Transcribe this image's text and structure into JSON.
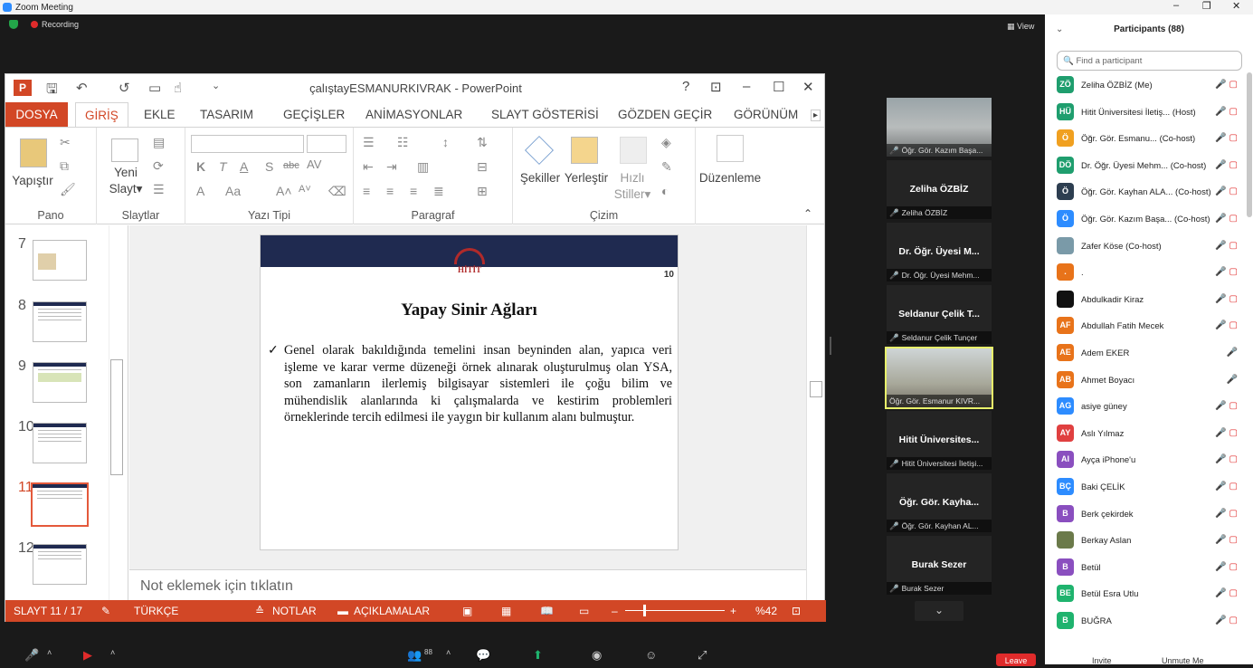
{
  "window": {
    "title": "Zoom Meeting"
  },
  "meeting": {
    "recording_label": "Recording",
    "view_label": "View"
  },
  "ppt": {
    "title": "çalıştayESMANURKIVRAK - PowerPoint",
    "tabs": [
      "DOSYA",
      "GİRİŞ",
      "EKLE",
      "TASARIM",
      "GEÇİŞLER",
      "ANİMASYONLAR",
      "SLAYT GÖSTERİSİ",
      "GÖZDEN GEÇİR",
      "GÖRÜNÜM"
    ],
    "ribbon": {
      "yapistir": "Yapıştır",
      "pano": "Pano",
      "yeni": "Yeni",
      "slayt": "Slayt",
      "slaytlar": "Slaytlar",
      "yazitipi": "Yazı Tipi",
      "paragraf": "Paragraf",
      "sekiller": "Şekiller",
      "yerlestir": "Yerleştir",
      "hizli": "Hızlı",
      "stiller": "Stiller",
      "cizim": "Çizim",
      "duzenleme": "Düzenleme",
      "k": "K",
      "t": "T",
      "a": "A",
      "s": "S",
      "abc": "abc",
      "av": "AV",
      "aa": "Aa"
    },
    "thumbnails": [
      "7",
      "8",
      "9",
      "10",
      "11",
      "12"
    ],
    "slide": {
      "number": "10",
      "logo": "HİTİT",
      "title": "Yapay Sinir Ağları",
      "body": "Genel olarak bakıldığında temelini insan beyninden alan, yapıca veri işleme ve karar verme düzeneği örnek alınarak oluşturulmuş olan YSA, son zamanların ilerlemiş bilgisayar sistemleri ile çoğu bilim ve mühendislik alanlarında ki çalışmalarda ve kestirim problemleri örneklerinde tercih edilmesi ile yaygın bir kullanım alanı bulmuştur."
    },
    "notes_placeholder": "Not eklemek için tıklatın",
    "status": {
      "slide": "SLAYT 11 / 17",
      "lang": "TÜRKÇE",
      "notes": "NOTLAR",
      "comments": "AÇIKLAMALAR",
      "zoom": "%42"
    }
  },
  "video_tiles": [
    {
      "name": "",
      "label": "Öğr. Gör. Kazım Başa..."
    },
    {
      "name": "Zeliha ÖZBİZ",
      "label": "Zeliha ÖZBİZ"
    },
    {
      "name": "Dr. Öğr. Üyesi M...",
      "label": "Dr. Öğr. Üyesi Mehm..."
    },
    {
      "name": "Seldanur Çelik T...",
      "label": "Seldanur Çelik Tunçer"
    },
    {
      "name": "",
      "label": "Öğr. Gör. Esmanur KIVR..."
    },
    {
      "name": "Hitit Üniversites...",
      "label": "Hitit Üniversitesi İletişi..."
    },
    {
      "name": "Öğr. Gör. Kayha...",
      "label": "Öğr. Gör. Kayhan AL..."
    },
    {
      "name": "Burak Sezer",
      "label": "Burak Sezer"
    }
  ],
  "participants": {
    "title": "Participants (88)",
    "search_placeholder": "Find a participant",
    "list": [
      {
        "initials": "ZÖ",
        "name": "Zeliha ÖZBİZ (Me)",
        "color": "#1f9e6e"
      },
      {
        "initials": "HÜ",
        "name": "Hitit Üniversitesi İletiş... (Host)",
        "color": "#1f9e6e"
      },
      {
        "initials": "Ö",
        "name": "Öğr. Gör. Esmanu... (Co-host)",
        "color": "#f0a020"
      },
      {
        "initials": "DÖ",
        "name": "Dr. Öğr. Üyesi Mehm... (Co-host)",
        "color": "#1f9e6e"
      },
      {
        "initials": "Ö",
        "name": "Öğr. Gör. Kayhan ALA... (Co-host)",
        "color": "#2d3e50"
      },
      {
        "initials": "Ö",
        "name": "Öğr. Gör. Kazım Başa... (Co-host)",
        "color": "#2d8cff"
      },
      {
        "initials": "",
        "name": "Zafer Köse (Co-host)",
        "color": "#7a9aa8"
      },
      {
        "initials": ".",
        "name": ".",
        "color": "#e8731a"
      },
      {
        "initials": "",
        "name": "Abdulkadir Kiraz",
        "color": "#111111"
      },
      {
        "initials": "AF",
        "name": "Abdullah Fatih Mecek",
        "color": "#e8731a"
      },
      {
        "initials": "AE",
        "name": "Adem EKER",
        "color": "#e8731a"
      },
      {
        "initials": "AB",
        "name": "Ahmet Boyacı",
        "color": "#e8731a"
      },
      {
        "initials": "AG",
        "name": "asiye güney",
        "color": "#2d8cff"
      },
      {
        "initials": "AY",
        "name": "Aslı Yılmaz",
        "color": "#e04040"
      },
      {
        "initials": "AI",
        "name": "Ayça iPhone'u",
        "color": "#8a4fbf"
      },
      {
        "initials": "BÇ",
        "name": "Baki ÇELİK",
        "color": "#2d8cff"
      },
      {
        "initials": "B",
        "name": "Berk çekirdek",
        "color": "#8a4fbf"
      },
      {
        "initials": "",
        "name": "Berkay Aslan",
        "color": "#6b7a4a"
      },
      {
        "initials": "B",
        "name": "Betül",
        "color": "#8a4fbf"
      },
      {
        "initials": "BE",
        "name": "Betül Esra Utlu",
        "color": "#1fb36e"
      },
      {
        "initials": "B",
        "name": "BUĞRA",
        "color": "#1fb36e"
      }
    ],
    "invite": "Invite",
    "unmute": "Unmute Me"
  },
  "toolbar": {
    "participants_count": "88",
    "leave": "Leave"
  }
}
